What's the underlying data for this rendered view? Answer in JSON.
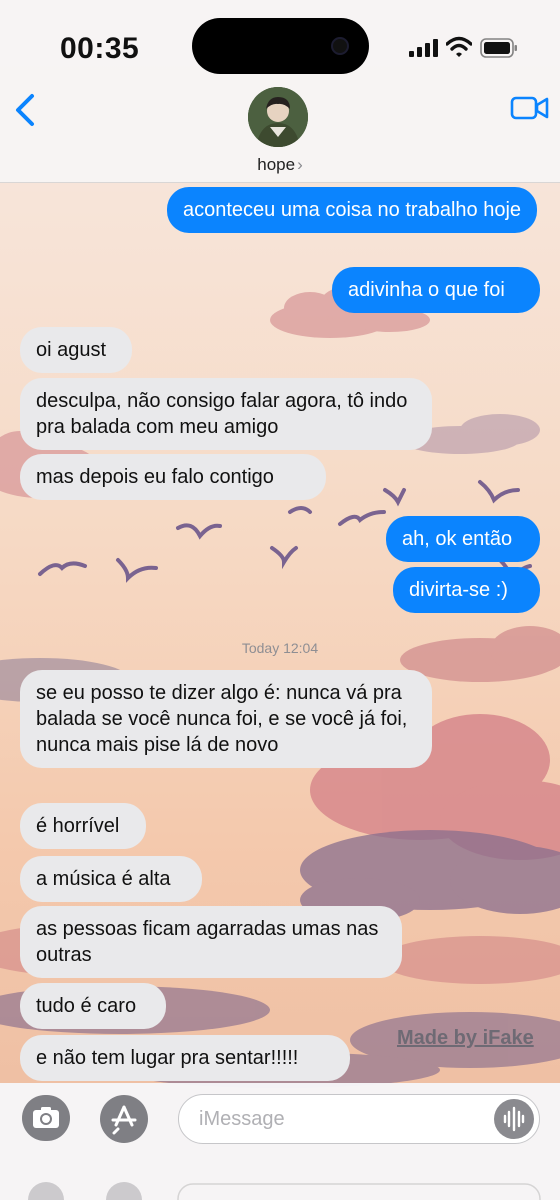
{
  "status_bar": {
    "time": "00:35"
  },
  "header": {
    "contact_name": "hope",
    "contact_chevron": "›"
  },
  "icons": {
    "back": "chevron-left-icon",
    "video": "video-camera-icon",
    "camera": "camera-icon",
    "apps": "app-store-icon",
    "audio": "audio-waveform-icon",
    "signal": "cellular-signal-icon",
    "wifi": "wifi-icon",
    "battery": "battery-icon"
  },
  "colors": {
    "accent": "#0b84fe",
    "incoming_bubble": "#e9e9eb",
    "timestamp": "#8e8e93"
  },
  "messages": [
    {
      "side": "out",
      "text": "aconteceu uma coisa no trabalho hoje"
    },
    {
      "side": "out",
      "text": "adivinha o que foi"
    },
    {
      "side": "in",
      "text": "oi agust"
    },
    {
      "side": "in",
      "text": "desculpa, não consigo falar agora, tô indo pra balada com meu amigo"
    },
    {
      "side": "in",
      "text": "mas depois eu falo contigo"
    },
    {
      "side": "out",
      "text": "ah, ok então"
    },
    {
      "side": "out",
      "text": "divirta-se :)"
    },
    {
      "side": "in",
      "text": "se eu posso te dizer algo é: nunca vá pra balada se você nunca foi, e se você já foi, nunca mais pise lá de novo"
    },
    {
      "side": "in",
      "text": "é horrível"
    },
    {
      "side": "in",
      "text": "a música é alta"
    },
    {
      "side": "in",
      "text": "as pessoas ficam agarradas umas nas outras"
    },
    {
      "side": "in",
      "text": "tudo é caro"
    },
    {
      "side": "in",
      "text": "e não tem lugar pra sentar!!!!!"
    }
  ],
  "timestamp": {
    "day": "Today",
    "time": "12:04"
  },
  "watermark": "Made by iFake",
  "input": {
    "placeholder": "iMessage"
  }
}
